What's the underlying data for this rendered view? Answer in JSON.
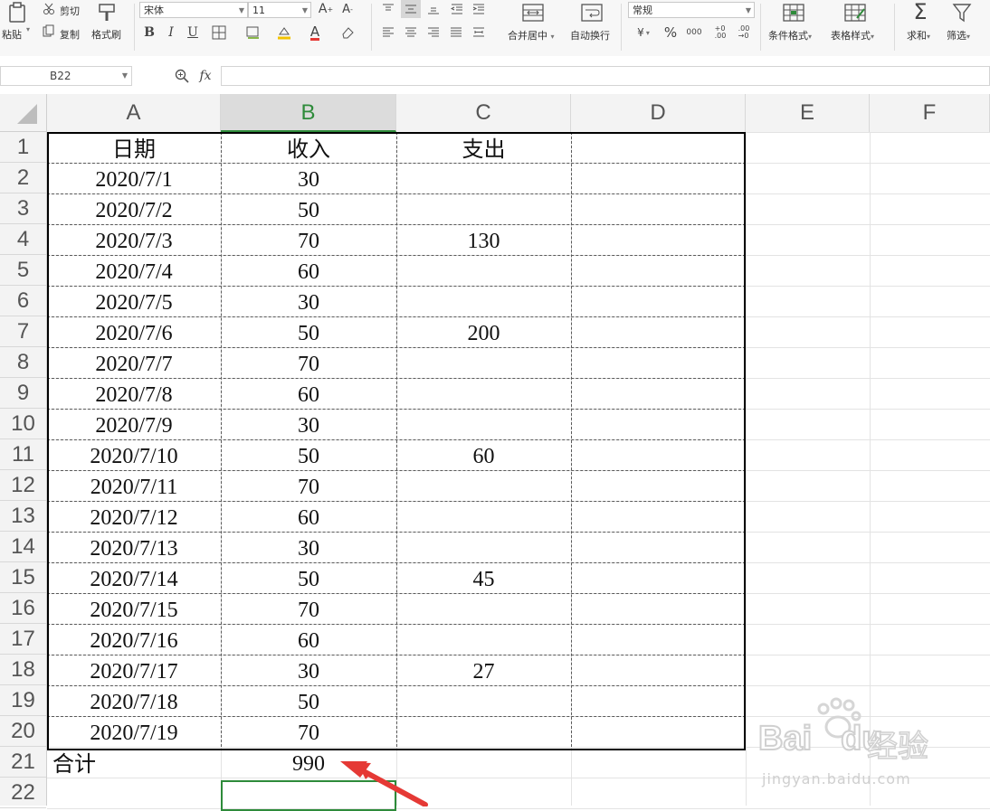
{
  "ribbon": {
    "paste": "粘贴",
    "cut": "剪切",
    "copy": "复制",
    "format_painter": "格式刷",
    "font_name": "宋体",
    "font_size": "11",
    "bold": "B",
    "italic": "I",
    "underline": "U",
    "merge_center": "合并居中",
    "auto_wrap": "自动换行",
    "number_format": "常规",
    "percent": "%",
    "cond_format": "条件格式",
    "table_style": "表格样式",
    "sum": "求和",
    "filter": "筛选"
  },
  "formula_bar": {
    "name_box": "B22",
    "fx": "fx",
    "value": ""
  },
  "columns": [
    "A",
    "B",
    "C",
    "D",
    "E",
    "F"
  ],
  "selected_column": "B",
  "rows": [
    "1",
    "2",
    "3",
    "4",
    "5",
    "6",
    "7",
    "8",
    "9",
    "10",
    "11",
    "12",
    "13",
    "14",
    "15",
    "16",
    "17",
    "18",
    "19",
    "20",
    "21",
    "22"
  ],
  "headers": {
    "a": "日期",
    "b": "收入",
    "c": "支出"
  },
  "data_rows": [
    {
      "date": "2020/7/1",
      "income": "30",
      "expense": ""
    },
    {
      "date": "2020/7/2",
      "income": "50",
      "expense": ""
    },
    {
      "date": "2020/7/3",
      "income": "70",
      "expense": "130"
    },
    {
      "date": "2020/7/4",
      "income": "60",
      "expense": ""
    },
    {
      "date": "2020/7/5",
      "income": "30",
      "expense": ""
    },
    {
      "date": "2020/7/6",
      "income": "50",
      "expense": "200"
    },
    {
      "date": "2020/7/7",
      "income": "70",
      "expense": ""
    },
    {
      "date": "2020/7/8",
      "income": "60",
      "expense": ""
    },
    {
      "date": "2020/7/9",
      "income": "30",
      "expense": ""
    },
    {
      "date": "2020/7/10",
      "income": "50",
      "expense": "60"
    },
    {
      "date": "2020/7/11",
      "income": "70",
      "expense": ""
    },
    {
      "date": "2020/7/12",
      "income": "60",
      "expense": ""
    },
    {
      "date": "2020/7/13",
      "income": "30",
      "expense": ""
    },
    {
      "date": "2020/7/14",
      "income": "50",
      "expense": "45"
    },
    {
      "date": "2020/7/15",
      "income": "70",
      "expense": ""
    },
    {
      "date": "2020/7/16",
      "income": "60",
      "expense": ""
    },
    {
      "date": "2020/7/17",
      "income": "30",
      "expense": "27"
    },
    {
      "date": "2020/7/18",
      "income": "50",
      "expense": ""
    },
    {
      "date": "2020/7/19",
      "income": "70",
      "expense": ""
    }
  ],
  "total_row": {
    "label": "合计",
    "income": "990"
  },
  "watermark": {
    "brand": "Bai",
    "brand2": "du",
    "cn": "经验",
    "url": "jingyan.baidu.com"
  },
  "colors": {
    "accent_green": "#2e8b3a",
    "arrow_red": "#e53935"
  }
}
